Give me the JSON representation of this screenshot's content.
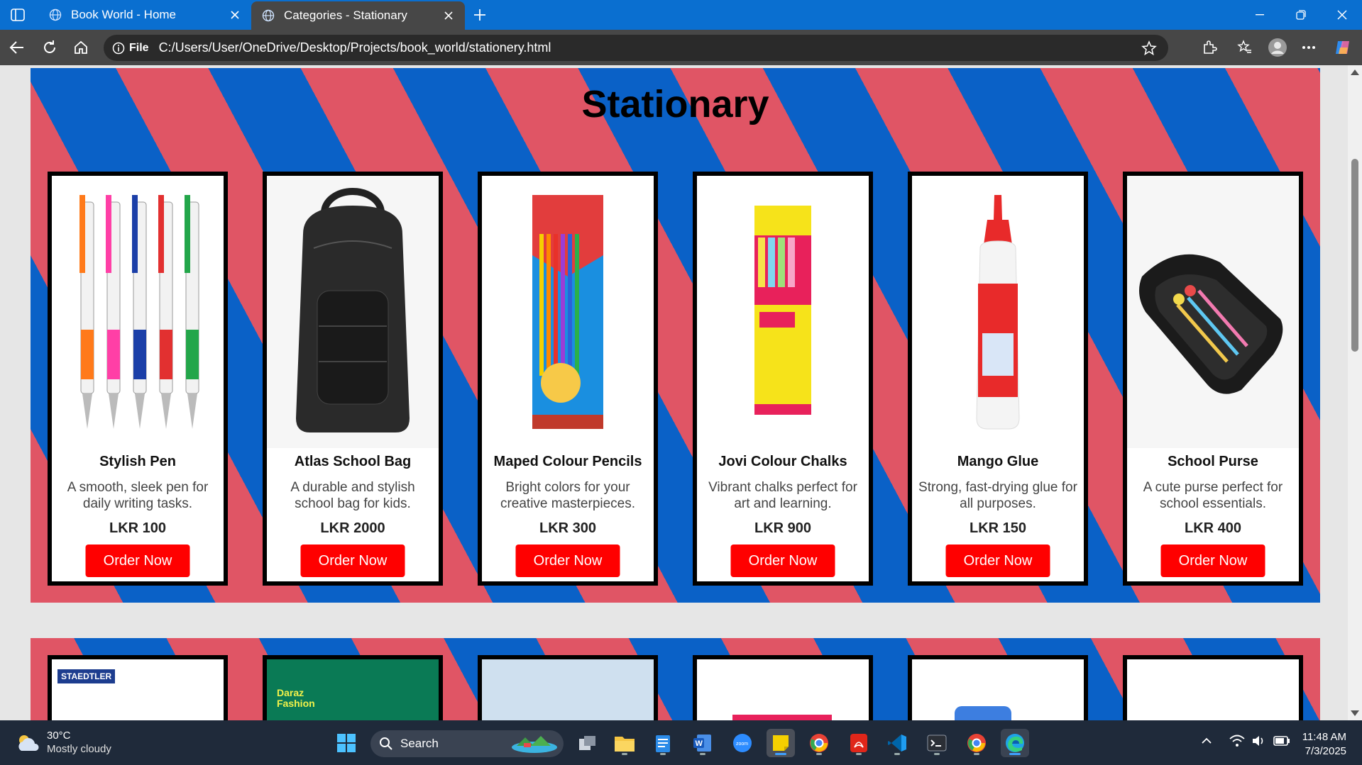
{
  "browser": {
    "tabs": [
      {
        "title": "Book World - Home"
      },
      {
        "title": "Categories - Stationary"
      }
    ],
    "address": {
      "scheme_label": "File",
      "url": "C:/Users/User/OneDrive/Desktop/Projects/book_world/stationery.html"
    }
  },
  "page": {
    "title": "Stationary",
    "products": [
      {
        "name": "Stylish Pen",
        "description": "A smooth, sleek pen for daily writing tasks.",
        "price": "LKR 100",
        "button": "Order Now"
      },
      {
        "name": "Atlas School Bag",
        "description": "A durable and stylish school bag for kids.",
        "price": "LKR 2000",
        "button": "Order Now"
      },
      {
        "name": "Maped Colour Pencils",
        "description": "Bright colors for your creative masterpieces.",
        "price": "LKR 300",
        "button": "Order Now"
      },
      {
        "name": "Jovi Colour Chalks",
        "description": "Vibrant chalks perfect for art and learning.",
        "price": "LKR 900",
        "button": "Order Now"
      },
      {
        "name": "Mango Glue",
        "description": "Strong, fast-drying glue for all purposes.",
        "price": "LKR 150",
        "button": "Order Now"
      },
      {
        "name": "School Purse",
        "description": "A cute purse perfect for school essentials.",
        "price": "LKR 400",
        "button": "Order Now"
      }
    ],
    "next_section_labels": [
      "STAEDTLER",
      "Daraz Fashion"
    ]
  },
  "taskbar": {
    "weather": {
      "temp": "30°C",
      "desc": "Mostly cloudy"
    },
    "search_label": "Search",
    "clock": {
      "time": "11:48 AM",
      "date": "7/3/2025"
    }
  },
  "colors": {
    "accent_red": "#ff0000",
    "pattern_red": "#e05565",
    "pattern_blue": "#0a61c7",
    "tab_bar": "#0a6fd0"
  }
}
